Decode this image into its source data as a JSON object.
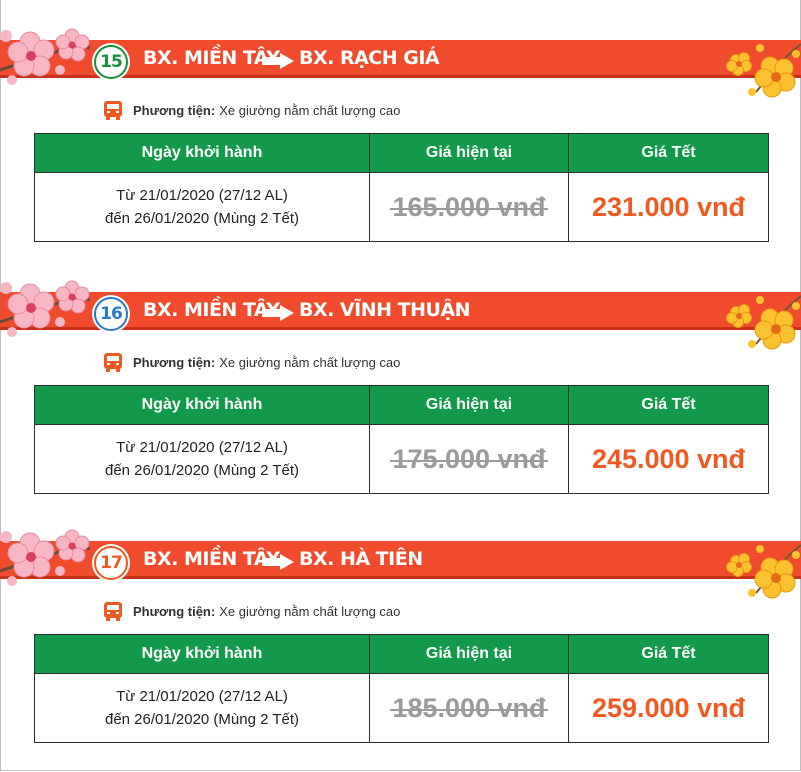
{
  "colors": {
    "banner": "#ef4b2c",
    "header_green": "#13994a",
    "new_price": "#ef5a22",
    "old_price": "#9b9b9b"
  },
  "routes": [
    {
      "number": "15",
      "badge_color": "#1b8f3c",
      "from": "BX. MIỀN TÂY",
      "to": "BX. RẠCH GIÁ",
      "vehicle_label": "Phương tiện:",
      "vehicle_value": "Xe giường nằm chất lượng cao",
      "headers": [
        "Ngày khởi hành",
        "Giá hiện tại",
        "Giá Tết"
      ],
      "date_line1": "Từ 21/01/2020 (27/12 AL)",
      "date_line2": "đến 26/01/2020 (Mùng 2 Tết)",
      "old_price": "165.000 vnđ",
      "new_price": "231.000 vnđ"
    },
    {
      "number": "16",
      "badge_color": "#2a76c9",
      "from": "BX. MIỀN TÂY",
      "to": "BX. VĨNH THUẬN",
      "vehicle_label": "Phương tiện:",
      "vehicle_value": "Xe giường nằm chất lượng cao",
      "headers": [
        "Ngày khởi hành",
        "Giá hiện tại",
        "Giá Tết"
      ],
      "date_line1": "Từ 21/01/2020 (27/12 AL)",
      "date_line2": "đến 26/01/2020 (Mùng 2 Tết)",
      "old_price": "175.000 vnđ",
      "new_price": "245.000 vnđ"
    },
    {
      "number": "17",
      "badge_color": "#ef5a22",
      "from": "BX. MIỀN TÂY",
      "to": "BX. HÀ TIÊN",
      "vehicle_label": "Phương tiện:",
      "vehicle_value": "Xe giường nằm chất lượng cao",
      "headers": [
        "Ngày khởi hành",
        "Giá hiện tại",
        "Giá Tết"
      ],
      "date_line1": "Từ 21/01/2020 (27/12 AL)",
      "date_line2": "đến 26/01/2020 (Mùng 2 Tết)",
      "old_price": "185.000 vnđ",
      "new_price": "259.000 vnđ"
    }
  ]
}
